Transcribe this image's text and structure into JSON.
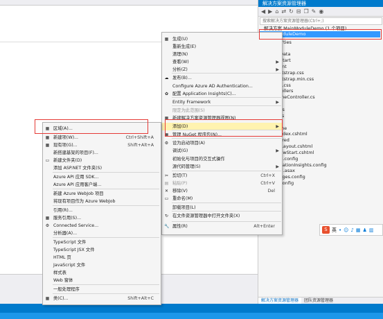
{
  "solution_explorer": {
    "title": "解决方案资源管理器",
    "search_placeholder": "搜索解决方案资源管理器(Ctrl+;)",
    "solution_label": "解决方案 MainModuleDemo (1 个项目)",
    "selected_project": "MainModuleDemo",
    "items": [
      "Properties",
      "引用",
      "App_Data",
      "App_Start",
      "Content",
      "bootstrap.css",
      "bootstrap.min.css",
      "Site.css",
      "Controllers",
      "HomeController.cs",
      "fonts",
      "Models",
      "Scripts",
      "Views",
      "Home",
      "Index.cshtml",
      "Shared",
      "_Layout.cshtml",
      "_ViewStart.cshtml",
      "web.config",
      "ApplicationInsights.config",
      "Global.asax",
      "packages.config",
      "Web.config"
    ],
    "tabs": [
      "解决方案资源管理器",
      "团队资源管理器"
    ]
  },
  "main_menu": {
    "items": [
      {
        "label": "生成(U)",
        "shortcut": "",
        "arrow": false
      },
      {
        "label": "重新生成(E)",
        "shortcut": "",
        "arrow": false
      },
      {
        "label": "清理(N)",
        "shortcut": "",
        "arrow": false
      },
      {
        "label": "查看(W)",
        "shortcut": "",
        "arrow": true
      },
      {
        "label": "分析(Z)",
        "shortcut": "",
        "arrow": true
      },
      {
        "label": "发布(B)...",
        "shortcut": "",
        "arrow": false
      },
      {
        "label": "Configure Azure AD Authentication...",
        "shortcut": "",
        "arrow": false
      },
      {
        "label": "配置 Application Insights(C)...",
        "shortcut": "",
        "arrow": false
      },
      {
        "label": "Entity Framework",
        "shortcut": "",
        "arrow": true
      },
      {
        "label": "限定为此范围(S)",
        "shortcut": "",
        "arrow": false
      },
      {
        "label": "新建解决方案资源管理器视图(N)",
        "shortcut": "",
        "arrow": false
      },
      {
        "label": "添加(D)",
        "shortcut": "",
        "arrow": true
      },
      {
        "label": "管理 NuGet 程序包(N)...",
        "shortcut": "",
        "arrow": false
      },
      {
        "label": "设为启动项目(A)",
        "shortcut": "",
        "arrow": false
      },
      {
        "label": "调试(G)",
        "shortcut": "",
        "arrow": true
      },
      {
        "label": "初始化与项目的交互式操作",
        "shortcut": "",
        "arrow": false
      },
      {
        "label": "源代码管理(S)",
        "shortcut": "",
        "arrow": true
      },
      {
        "label": "剪切(T)",
        "shortcut": "Ctrl+X",
        "arrow": false
      },
      {
        "label": "粘贴(P)",
        "shortcut": "Ctrl+V",
        "arrow": false
      },
      {
        "label": "移除(V)",
        "shortcut": "Del",
        "arrow": false
      },
      {
        "label": "重命名(M)",
        "shortcut": "",
        "arrow": false
      },
      {
        "label": "卸载项目(L)",
        "shortcut": "",
        "arrow": false
      },
      {
        "label": "在文件资源管理器中打开文件夹(X)",
        "shortcut": "",
        "arrow": false
      },
      {
        "label": "属性(R)",
        "shortcut": "Alt+Enter",
        "arrow": false
      }
    ]
  },
  "sub_menu": {
    "items": [
      {
        "label": "区域(A)...",
        "shortcut": ""
      },
      {
        "label": "新建项(W)...",
        "shortcut": "Ctrl+Shift+A"
      },
      {
        "label": "现有项(G)...",
        "shortcut": "Shift+Alt+A"
      },
      {
        "label": "新搭建基架的项目(F)...",
        "shortcut": ""
      },
      {
        "label": "新建文件夹(D)",
        "shortcut": ""
      },
      {
        "label": "添加 ASP.NET 文件夹(S)",
        "shortcut": ""
      },
      {
        "label": "Azure API 应用 SDK...",
        "shortcut": ""
      },
      {
        "label": "Azure API 应用客户端...",
        "shortcut": ""
      },
      {
        "label": "新建 Azure WebJob 项目",
        "shortcut": ""
      },
      {
        "label": "将现有项目作为 Azure WebJob",
        "shortcut": ""
      },
      {
        "label": "引用(R)...",
        "shortcut": ""
      },
      {
        "label": "服务引用(S)...",
        "shortcut": ""
      },
      {
        "label": "Connected Service...",
        "shortcut": ""
      },
      {
        "label": "分析器(A)...",
        "shortcut": ""
      },
      {
        "label": "TypeScript 文件",
        "shortcut": ""
      },
      {
        "label": "TypeScript JSX 文件",
        "shortcut": ""
      },
      {
        "label": "HTML 页",
        "shortcut": ""
      },
      {
        "label": "JavaScript 文件",
        "shortcut": ""
      },
      {
        "label": "样式表",
        "shortcut": ""
      },
      {
        "label": "Web 窗体",
        "shortcut": ""
      },
      {
        "label": "一般处理程序",
        "shortcut": ""
      },
      {
        "label": "类(C)...",
        "shortcut": "Shift+Alt+C"
      }
    ]
  },
  "ime": {
    "label": "英"
  },
  "colors": {
    "accent": "#007acc",
    "highlight": "#fff3b0",
    "annotation": "#e53935",
    "selection": "#3399ff"
  }
}
